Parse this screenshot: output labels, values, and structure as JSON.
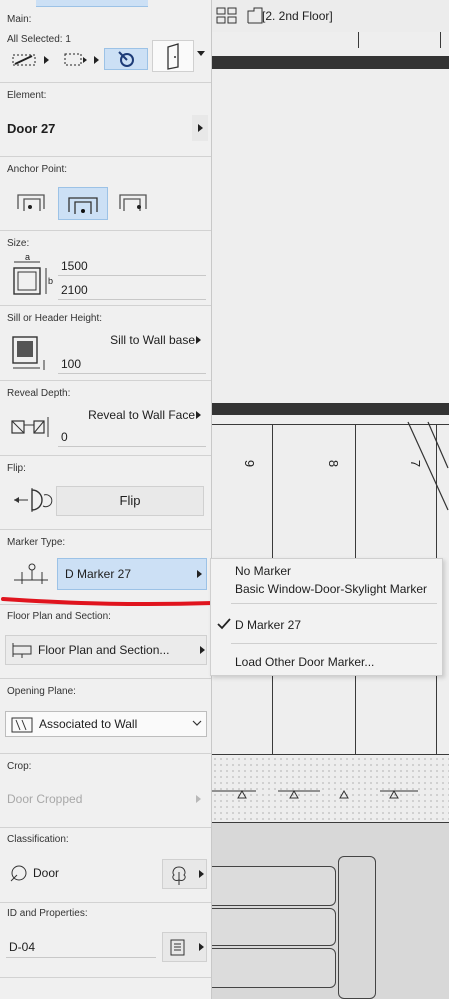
{
  "toolbar": {
    "floor_label": "[2. 2nd Floor]"
  },
  "main": {
    "heading": "Main:",
    "selection": "All Selected: 1"
  },
  "element": {
    "heading": "Element:",
    "name": "Door 27"
  },
  "anchor": {
    "heading": "Anchor Point:"
  },
  "size": {
    "heading": "Size:",
    "width": "1500",
    "height": "2100",
    "a_label": "a",
    "b_label": "b"
  },
  "sill": {
    "heading": "Sill or Header Height:",
    "mode": "Sill to Wall base",
    "value": "100"
  },
  "reveal": {
    "heading": "Reveal Depth:",
    "mode": "Reveal to Wall Face",
    "value": "0"
  },
  "flip": {
    "heading": "Flip:",
    "button": "Flip"
  },
  "marker": {
    "heading": "Marker Type:",
    "selected": "D Marker 27"
  },
  "floor_plan": {
    "heading": "Floor Plan and Section:",
    "button": "Floor Plan and Section..."
  },
  "opening": {
    "heading": "Opening Plane:",
    "value": "Associated to Wall"
  },
  "crop": {
    "heading": "Crop:",
    "value": "Door Cropped"
  },
  "classification": {
    "heading": "Classification:",
    "value": "Door"
  },
  "id": {
    "heading": "ID and Properties:",
    "value": "D-04"
  },
  "menu": {
    "items": [
      "No Marker",
      "Basic Window-Door-Skylight Marker",
      "D Marker 27",
      "Load Other Door Marker..."
    ],
    "checked": "D Marker 27"
  },
  "drawing": {
    "numbers": [
      "9",
      "8",
      "7"
    ]
  },
  "colors": {
    "selection": "#cce0f5",
    "annotation": "#e0141e",
    "accent": "#3d7fc1"
  }
}
